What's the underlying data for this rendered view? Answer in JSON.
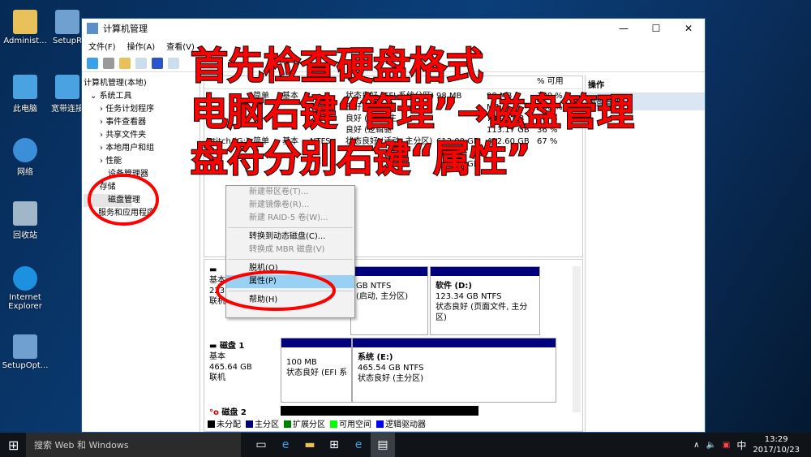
{
  "desktop": {
    "icons": [
      "Administ...",
      "此电脑",
      "网络",
      "回收站",
      "Internet Explorer",
      "SetupOpt..."
    ],
    "icon2": [
      "SetupR",
      "宽带连接"
    ]
  },
  "window": {
    "title": "计算机管理",
    "controls": [
      "—",
      "☐",
      "✕"
    ],
    "menu": [
      "文件(F)",
      "操作(A)",
      "查看(V)"
    ],
    "tree": [
      "计算机管理(本地)",
      "系统工具",
      "任务计划程序",
      "事件查看器",
      "共享文件夹",
      "本地用户和组",
      "性能",
      "设备管理器",
      "存储",
      "磁盘管理",
      "服务和应用程序"
    ],
    "table": {
      "headers": [
        "% 可用"
      ],
      "rows": [
        [
          "",
          "简单",
          "基本",
          "",
          "状态良好 (EFI 系统分区)",
          "98 MB",
          "98 MB",
          "100 %"
        ],
        [
          "",
          "",
          "",
          "",
          "良好 (E",
          "",
          "MB",
          "100 %"
        ],
        [
          "",
          "",
          "",
          "",
          "良好 (启动, 主",
          "",
          "79.97 GB",
          "36 %"
        ],
        [
          "",
          "",
          "",
          "",
          "良好 (逻辑驱",
          "",
          "113.17 GB",
          "36 %"
        ],
        [
          "Stitch (G:)",
          "简单",
          "基本",
          "NTFS",
          "状态良好 (活动, 主分区)",
          "613.00 GB",
          "412.60 GB",
          "67 %"
        ],
        [
          "",
          "",
          "",
          "",
          "",
          "123.3",
          "",
          ""
        ],
        [
          "",
          "",
          "",
          "",
          "",
          "465.54 GB",
          "",
          ""
        ]
      ]
    },
    "actions": {
      "header": "操作",
      "item": "磁盘管理"
    },
    "context_menu": [
      {
        "label": "新建带区卷(T)...",
        "disabled": true
      },
      {
        "label": "新建镜像卷(R)...",
        "disabled": true
      },
      {
        "label": "新建 RAID-5 卷(W)...",
        "disabled": true
      },
      {
        "label": "转换到动态磁盘(C)...",
        "disabled": false
      },
      {
        "label": "转换成 MBR 磁盘(V)",
        "disabled": true
      },
      {
        "label": "脱机(O)",
        "disabled": false
      },
      {
        "label": "属性(P)",
        "disabled": false,
        "highlighted": true
      },
      {
        "label": "帮助(H)",
        "disabled": false
      }
    ],
    "disk0": {
      "type": "基本",
      "size": "223.",
      "status": "联机",
      "parts": [
        {
          "l1": "GB NTFS",
          "l2": "(启动, 主分区)"
        },
        {
          "name": "软件 (D:)",
          "l1": "123.34 GB NTFS",
          "l2": "状态良好 (页面文件, 主分区)"
        }
      ]
    },
    "disk1": {
      "name": "磁盘 1",
      "type": "基本",
      "size": "465.64 GB",
      "status": "联机",
      "parts": [
        {
          "l1": "100 MB",
          "l2": "状态良好 (EFI 系统"
        },
        {
          "name": "系统 (E:)",
          "l1": "465.54 GB NTFS",
          "l2": "状态良好 (主分区)"
        }
      ]
    },
    "disk2": {
      "name": "磁盘 2"
    },
    "legend": [
      {
        "label": "未分配",
        "color": "#000000"
      },
      {
        "label": "主分区",
        "color": "#00007f"
      },
      {
        "label": "扩展分区",
        "color": "#008000"
      },
      {
        "label": "可用空间",
        "color": "#00ff00"
      },
      {
        "label": "逻辑驱动器",
        "color": "#0000ff"
      }
    ]
  },
  "overlay": {
    "line1": "首先检查硬盘格式",
    "line2": "电脑右键“管理”→磁盘管理",
    "line3": "盘符分别右键“属性”",
    "color": "#ff0000"
  },
  "taskbar": {
    "search": "搜索 Web 和 Windows",
    "ime": "中",
    "time": "13:29",
    "date": "2017/10/23"
  }
}
